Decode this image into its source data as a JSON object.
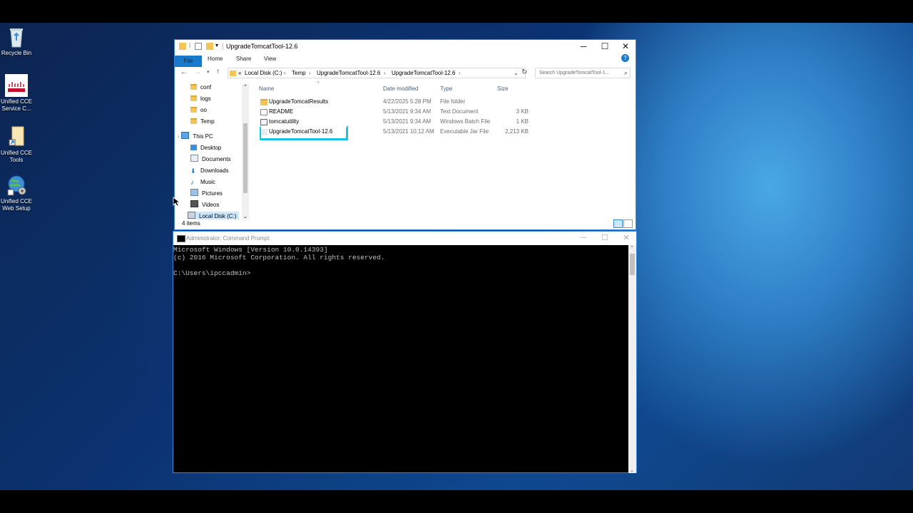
{
  "desktop": {
    "icons": [
      {
        "label": "Recycle Bin"
      },
      {
        "label": "Unified CCE Service C..."
      },
      {
        "label": "Unified CCE Tools"
      },
      {
        "label": "Unified CCE Web Setup"
      }
    ]
  },
  "explorer": {
    "title": "UpgradeTomcatTool-12.6",
    "ribbon": {
      "file": "File",
      "home": "Home",
      "share": "Share",
      "view": "View"
    },
    "address": {
      "prefix": "«",
      "crumbs": [
        "Local Disk (C:)",
        "Temp",
        "UpgradeTomcatTool-12.6",
        "UpgradeTomcatTool-12.6"
      ]
    },
    "search_placeholder": "Search UpgradeTomcatTool-1...",
    "nav": {
      "items": [
        "conf",
        "logs",
        "oo",
        "Temp",
        "This PC",
        "Desktop",
        "Documents",
        "Downloads",
        "Music",
        "Pictures",
        "Videos",
        "Local Disk (C:)"
      ]
    },
    "columns": {
      "name": "Name",
      "date": "Date modified",
      "type": "Type",
      "size": "Size"
    },
    "files": [
      {
        "name": "UpgradeTomcatResults",
        "date": "4/22/2025 5:28 PM",
        "type": "File folder",
        "size": ""
      },
      {
        "name": "README",
        "date": "5/13/2021 9:34 AM",
        "type": "Text Document",
        "size": "3 KB"
      },
      {
        "name": "tomcatutility",
        "date": "5/13/2021 9:34 AM",
        "type": "Windows Batch File",
        "size": "1 KB"
      },
      {
        "name": "UpgradeTomcatTool-12.6",
        "date": "5/13/2021 10:12 AM",
        "type": "Executable Jar File",
        "size": "2,213 KB"
      }
    ],
    "status": "4 items"
  },
  "cmd": {
    "title": "Administrator: Command Prompt",
    "line1": "Microsoft Windows [Version 10.0.14393]",
    "line2": "(c) 2016 Microsoft Corporation. All rights reserved.",
    "prompt": "C:\\Users\\ipccadmin>"
  },
  "colors": {
    "highlight": "#17c3e6",
    "accent": "#1979ca",
    "folder": "#f3c557"
  }
}
